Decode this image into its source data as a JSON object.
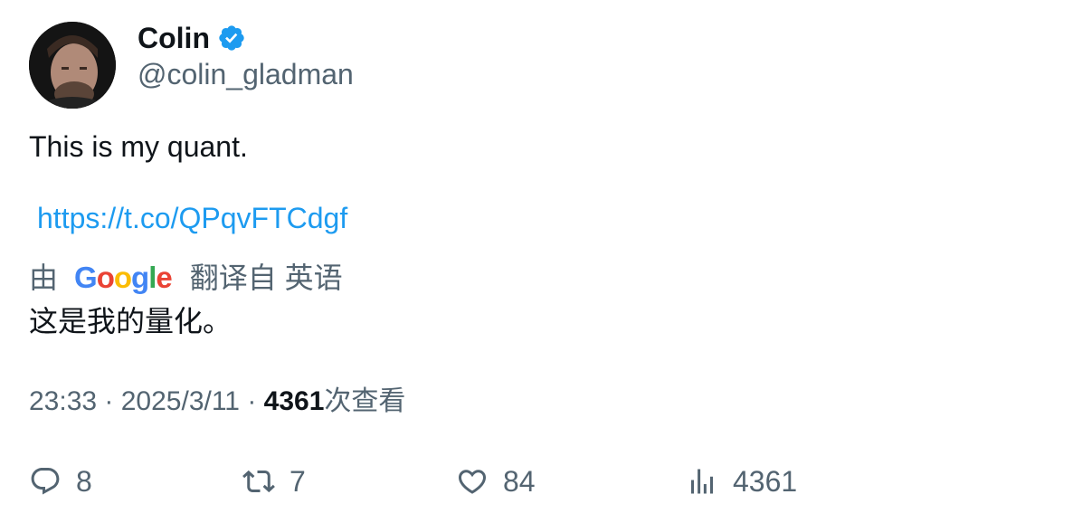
{
  "author": {
    "name": "Colin",
    "handle": "@colin_gladman"
  },
  "tweet": {
    "text": "This is my quant.",
    "link": "https://t.co/QPqvFTCdgf"
  },
  "translation": {
    "by_label": "由",
    "provider_letters": [
      "G",
      "o",
      "o",
      "g",
      "l",
      "e"
    ],
    "provider_colors": [
      "#4285F4",
      "#EA4335",
      "#FBBC05",
      "#4285F4",
      "#34A853",
      "#EA4335"
    ],
    "from_label": "翻译自 英语",
    "text": "这是我的量化。"
  },
  "meta": {
    "time": "23:33",
    "separator": " · ",
    "date": "2025/3/11",
    "views_count": "4361",
    "views_label": "次查看"
  },
  "actions": {
    "reply_count": "8",
    "retweet_count": "7",
    "like_count": "84",
    "views_count": "4361"
  },
  "colors": {
    "accent": "#1d9bf0",
    "muted": "#536471",
    "text": "#0f1419"
  }
}
